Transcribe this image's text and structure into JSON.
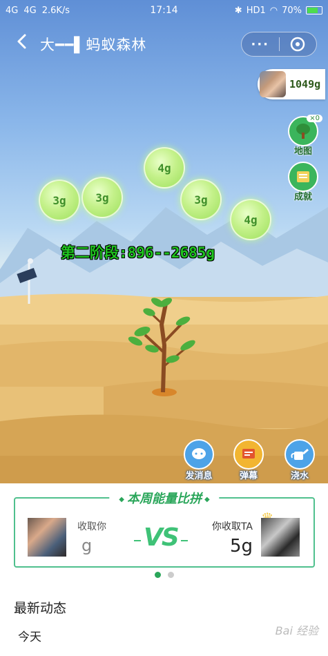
{
  "status_bar": {
    "signal1": "4G",
    "signal2": "4G",
    "speed": "2.6K/s",
    "time": "17:14",
    "hd": "HD1",
    "battery": "70%"
  },
  "header": {
    "title": "大━━▌蚂蚁森林",
    "more": "···"
  },
  "energy": {
    "total": "1049g"
  },
  "side_buttons": {
    "map_label": "地图",
    "map_badge": "×0",
    "achievement_label": "成就"
  },
  "bubbles": [
    "3g",
    "3g",
    "4g",
    "3g",
    "4g"
  ],
  "stage_text": "第二阶段:896--2685g",
  "actions": {
    "message": "发消息",
    "danmaku": "弹幕",
    "water": "浇水"
  },
  "vs_card": {
    "title": "本周能量比拼",
    "left_label": "收取你",
    "left_value": "g",
    "vs": "VS",
    "right_label": "你收取TA",
    "right_value": "5g"
  },
  "feed": {
    "title": "最新动态",
    "today": "今天"
  },
  "watermark": "Bai 经验",
  "colors": {
    "accent_green": "#2aa65a",
    "stage_text": "#1fc41f",
    "message_button": "#4da3e8",
    "danmaku_button": "#f2b531",
    "water_button": "#4da3e8"
  }
}
